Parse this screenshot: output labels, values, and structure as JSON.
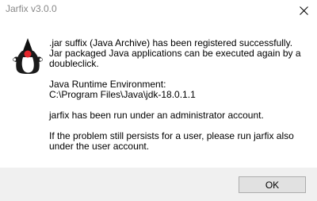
{
  "window": {
    "title": "Jarfix v3.0.0",
    "close_icon": "close-icon"
  },
  "icon": {
    "name": "java-duke-icon"
  },
  "message": {
    "paragraphs": [
      ".jar suffix (Java Archive) has been registered successfully.\nJar packaged Java applications can be executed again by a\ndoubleclick.",
      "Java Runtime Environment:\nC:\\Program Files\\Java\\jdk-18.0.1.1",
      "jarfix has been run under an administrator account.",
      "If the problem still persists for a user, please run jarfix also\nunder the user account."
    ]
  },
  "footer": {
    "ok_label": "OK"
  }
}
